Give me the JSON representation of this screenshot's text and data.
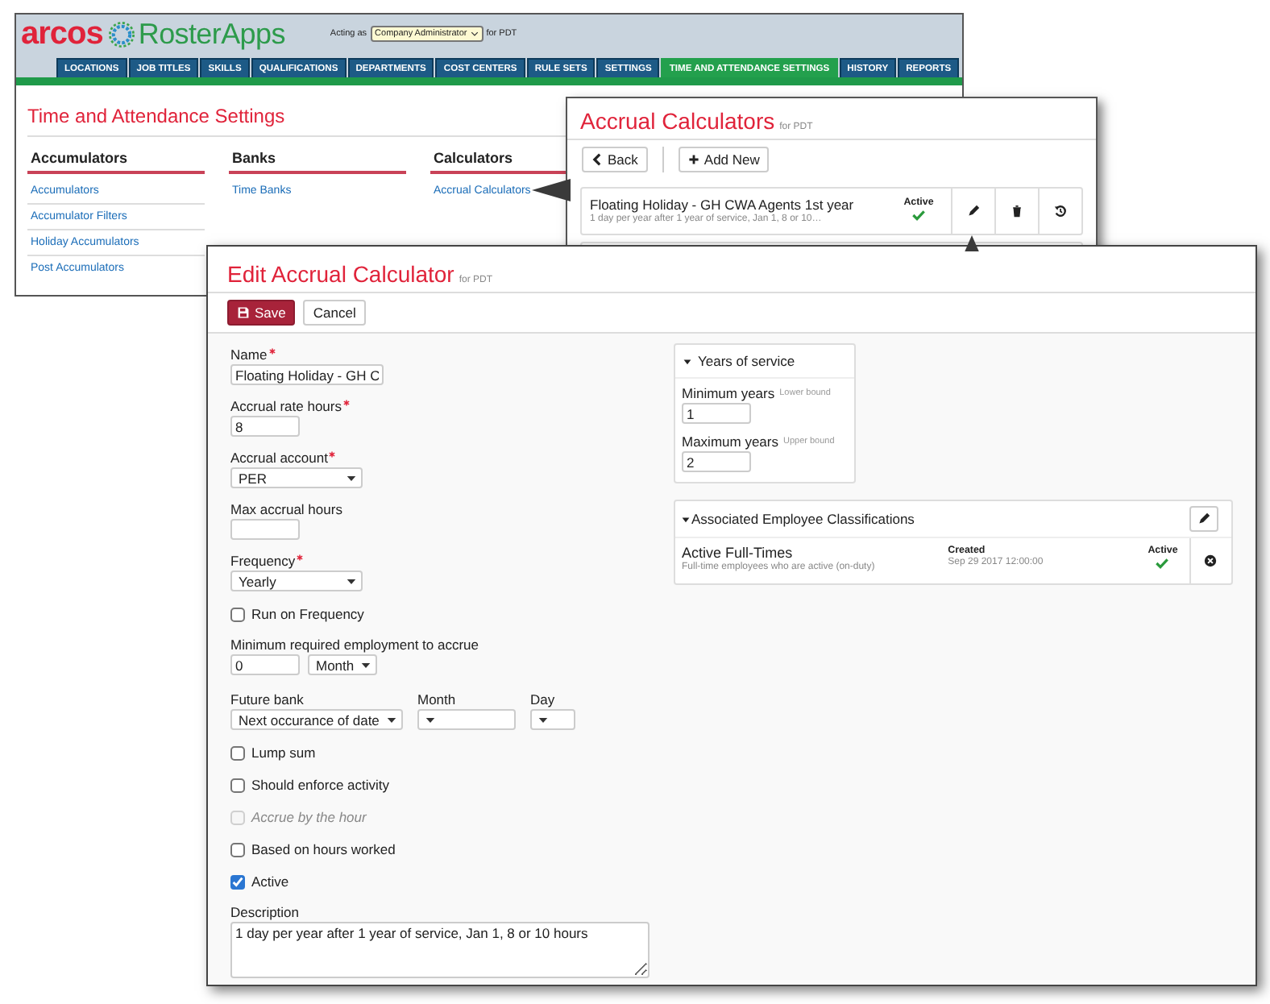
{
  "app": {
    "logo_brand": "arcos",
    "logo_product": "RosterApps",
    "acting_as_label": "Acting as",
    "role": "Company Administrator",
    "for_label": "for PDT",
    "nav_tabs": [
      {
        "label": "LOCATIONS",
        "selected": false
      },
      {
        "label": "JOB TITLES",
        "selected": false
      },
      {
        "label": "SKILLS",
        "selected": false
      },
      {
        "label": "QUALIFICATIONS",
        "selected": false
      },
      {
        "label": "DEPARTMENTS",
        "selected": false
      },
      {
        "label": "COST CENTERS",
        "selected": false
      },
      {
        "label": "RULE SETS",
        "selected": false
      },
      {
        "label": "SETTINGS",
        "selected": false
      },
      {
        "label": "TIME AND ATTENDANCE SETTINGS",
        "selected": true
      },
      {
        "label": "HISTORY",
        "selected": false
      },
      {
        "label": "REPORTS",
        "selected": false
      }
    ],
    "page_title": "Time and Attendance Settings",
    "sections": [
      {
        "heading": "Accumulators",
        "links": [
          "Accumulators",
          "Accumulator Filters",
          "Holiday Accumulators",
          "Post Accumulators"
        ]
      },
      {
        "heading": "Banks",
        "links": [
          "Time Banks"
        ]
      },
      {
        "heading": "Calculators",
        "links": [
          "Accrual Calculators"
        ]
      }
    ]
  },
  "list_dialog": {
    "title": "Accrual Calculators",
    "subtitle": "for PDT",
    "buttons": [
      {
        "kind": "back",
        "label": "Back"
      },
      {
        "kind": "add",
        "label": "Add New"
      }
    ],
    "rows": [
      {
        "name": "Floating Holiday - GH CWA Agents 1st year",
        "description": "1 day per year after 1 year of service, Jan 1, 8 or 10…",
        "status_label": "Active",
        "active": true
      }
    ]
  },
  "edit_dialog": {
    "title": "Edit Accrual Calculator",
    "subtitle": "for PDT",
    "save_label": "Save",
    "cancel_label": "Cancel",
    "fields": [
      {
        "kind": "text",
        "label": "Name",
        "required": true,
        "value": "Floating Holiday - GH C"
      },
      {
        "kind": "number",
        "label": "Accrual rate hours",
        "required": true,
        "value": "8"
      },
      {
        "kind": "select",
        "label": "Accrual account",
        "required": true,
        "value": "PER"
      },
      {
        "kind": "number",
        "label": "Max accrual hours",
        "required": false
      },
      {
        "kind": "select",
        "label": "Frequency",
        "required": true,
        "value": "Yearly"
      },
      {
        "kind": "checkbox",
        "label": "Run on Frequency",
        "checked": false,
        "disabled": false
      },
      {
        "kind": "duration",
        "label": "Minimum required employment to accrue",
        "value": "0",
        "unit": "Month"
      },
      {
        "kind": "date-parts",
        "parts": [
          {
            "label": "Future bank",
            "value": "Next occurance of date"
          },
          {
            "label": "Month"
          },
          {
            "label": "Day"
          }
        ]
      },
      {
        "kind": "checkbox",
        "label": "Lump sum",
        "checked": false,
        "disabled": false
      },
      {
        "kind": "checkbox",
        "label": "Should enforce activity",
        "checked": false,
        "disabled": false
      },
      {
        "kind": "checkbox",
        "label": "Accrue by the hour",
        "checked": false,
        "disabled": true
      },
      {
        "kind": "checkbox",
        "label": "Based on hours worked",
        "checked": false,
        "disabled": false
      },
      {
        "kind": "checkbox",
        "label": "Active",
        "checked": true,
        "disabled": false
      },
      {
        "kind": "textarea",
        "label": "Description",
        "value": "1 day per year after 1 year of service, Jan 1, 8 or 10 hours"
      }
    ],
    "years_panel": {
      "title": "Years of service",
      "expanded": true,
      "fields": [
        {
          "label": "Minimum years",
          "hint": "Lower bound",
          "value": "1"
        },
        {
          "label": "Maximum years",
          "hint": "Upper bound",
          "value": "2"
        }
      ]
    },
    "classifications_panel": {
      "title": "Associated Employee Classifications",
      "expanded": true,
      "rows": [
        {
          "name": "Active Full-Times",
          "description": "Full-time employees who are active (on-duty)",
          "created_label": "Created",
          "created": "Sep 29 2017 12:00:00",
          "status_label": "Active",
          "active": true
        }
      ]
    }
  }
}
